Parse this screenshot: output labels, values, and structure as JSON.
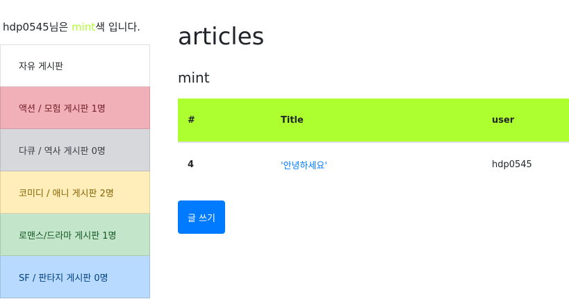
{
  "greeting": {
    "username": "hdp0545",
    "before": "님은 ",
    "color_word": "mint",
    "after": "색 입니다."
  },
  "sidebar": {
    "items": [
      {
        "label": "자유 게시판"
      },
      {
        "label": "액션 / 모험 게시판 1명"
      },
      {
        "label": "다큐 / 역사 게시판 0명"
      },
      {
        "label": "코미디 / 애니 게시판 2명"
      },
      {
        "label": "로맨스/드라마 게시판 1명"
      },
      {
        "label": "SF / 판타지 게시판 0명"
      }
    ]
  },
  "main": {
    "title": "articles",
    "subtitle": "mint",
    "table": {
      "headers": [
        "#",
        "Title",
        "user"
      ],
      "rows": [
        {
          "num": "4",
          "title": "'안녕하세요'",
          "user": "hdp0545"
        }
      ]
    },
    "write_button": "글 쓰기"
  },
  "colors": {
    "header_bg": "#adff2f",
    "link": "#007bff",
    "button": "#007bff"
  }
}
